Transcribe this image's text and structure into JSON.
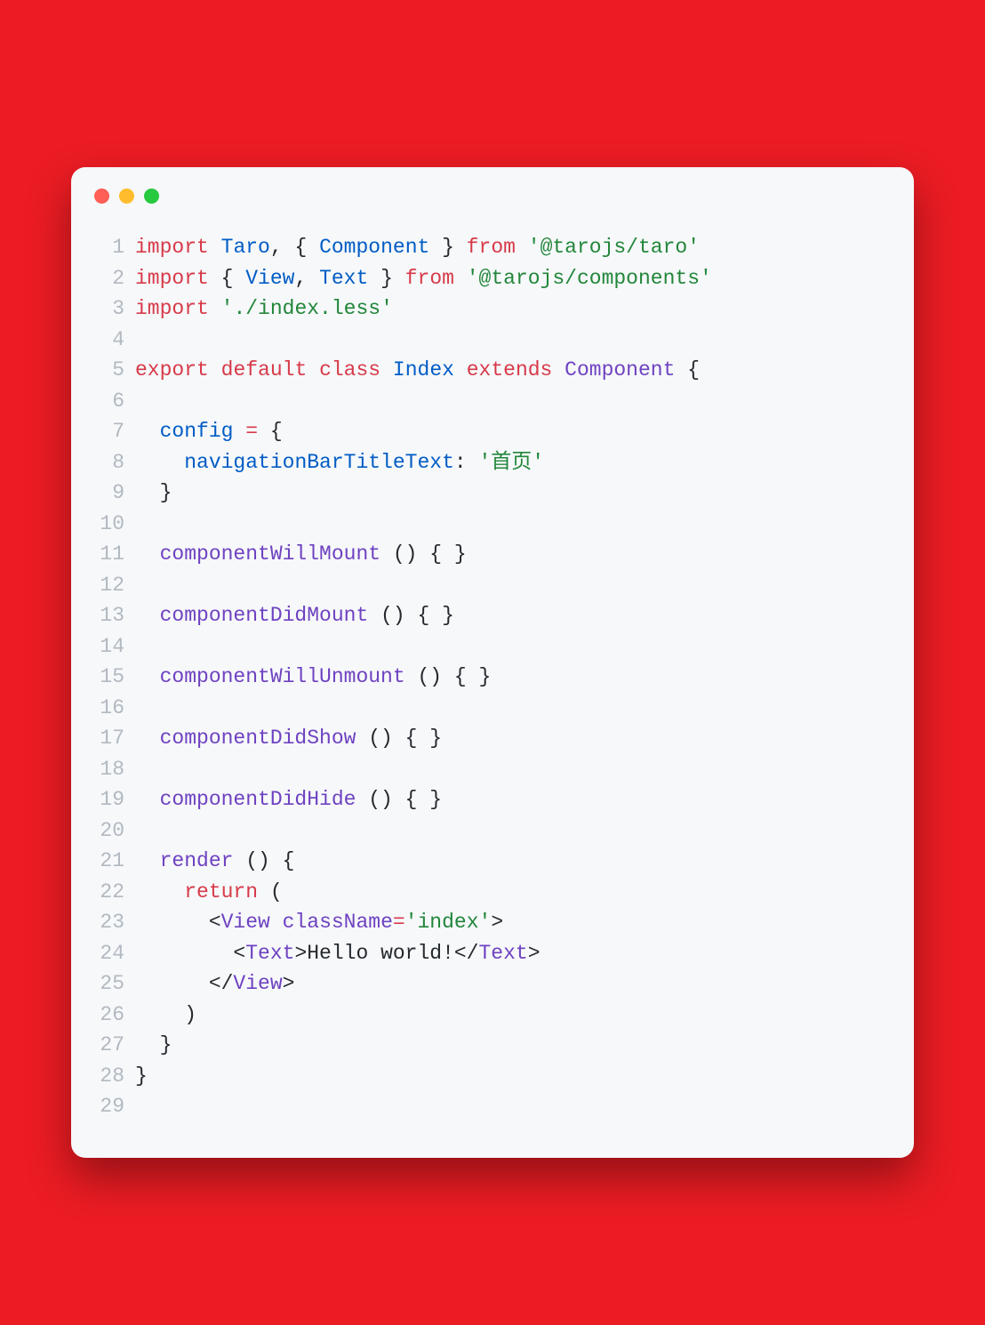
{
  "window": {
    "dots": [
      "red",
      "yellow",
      "green"
    ]
  },
  "code": {
    "lines": [
      {
        "n": 1,
        "tokens": [
          {
            "c": "kw",
            "t": "import"
          },
          {
            "c": "pl",
            "t": " "
          },
          {
            "c": "cls",
            "t": "Taro"
          },
          {
            "c": "pl",
            "t": ", { "
          },
          {
            "c": "cls",
            "t": "Component"
          },
          {
            "c": "pl",
            "t": " } "
          },
          {
            "c": "kw",
            "t": "from"
          },
          {
            "c": "pl",
            "t": " "
          },
          {
            "c": "str",
            "t": "'@tarojs/taro'"
          }
        ]
      },
      {
        "n": 2,
        "tokens": [
          {
            "c": "kw",
            "t": "import"
          },
          {
            "c": "pl",
            "t": " { "
          },
          {
            "c": "cls",
            "t": "View"
          },
          {
            "c": "pl",
            "t": ", "
          },
          {
            "c": "cls",
            "t": "Text"
          },
          {
            "c": "pl",
            "t": " } "
          },
          {
            "c": "kw",
            "t": "from"
          },
          {
            "c": "pl",
            "t": " "
          },
          {
            "c": "str",
            "t": "'@tarojs/components'"
          }
        ]
      },
      {
        "n": 3,
        "tokens": [
          {
            "c": "kw",
            "t": "import"
          },
          {
            "c": "pl",
            "t": " "
          },
          {
            "c": "str",
            "t": "'./index.less'"
          }
        ]
      },
      {
        "n": 4,
        "tokens": []
      },
      {
        "n": 5,
        "tokens": [
          {
            "c": "kw",
            "t": "export"
          },
          {
            "c": "pl",
            "t": " "
          },
          {
            "c": "kw",
            "t": "default"
          },
          {
            "c": "pl",
            "t": " "
          },
          {
            "c": "kw",
            "t": "class"
          },
          {
            "c": "pl",
            "t": " "
          },
          {
            "c": "cls",
            "t": "Index"
          },
          {
            "c": "pl",
            "t": " "
          },
          {
            "c": "kw",
            "t": "extends"
          },
          {
            "c": "pl",
            "t": " "
          },
          {
            "c": "def",
            "t": "Component"
          },
          {
            "c": "pl",
            "t": " {"
          }
        ]
      },
      {
        "n": 6,
        "tokens": []
      },
      {
        "n": 7,
        "tokens": [
          {
            "c": "pl",
            "t": "  "
          },
          {
            "c": "cls",
            "t": "config"
          },
          {
            "c": "pl",
            "t": " "
          },
          {
            "c": "kw",
            "t": "="
          },
          {
            "c": "pl",
            "t": " {"
          }
        ]
      },
      {
        "n": 8,
        "tokens": [
          {
            "c": "pl",
            "t": "    "
          },
          {
            "c": "attr",
            "t": "navigationBarTitleText"
          },
          {
            "c": "pl",
            "t": ": "
          },
          {
            "c": "str",
            "t": "'首页'"
          }
        ]
      },
      {
        "n": 9,
        "tokens": [
          {
            "c": "pl",
            "t": "  }"
          }
        ]
      },
      {
        "n": 10,
        "tokens": []
      },
      {
        "n": 11,
        "tokens": [
          {
            "c": "pl",
            "t": "  "
          },
          {
            "c": "def",
            "t": "componentWillMount"
          },
          {
            "c": "pl",
            "t": " () { }"
          }
        ]
      },
      {
        "n": 12,
        "tokens": []
      },
      {
        "n": 13,
        "tokens": [
          {
            "c": "pl",
            "t": "  "
          },
          {
            "c": "def",
            "t": "componentDidMount"
          },
          {
            "c": "pl",
            "t": " () { }"
          }
        ]
      },
      {
        "n": 14,
        "tokens": []
      },
      {
        "n": 15,
        "tokens": [
          {
            "c": "pl",
            "t": "  "
          },
          {
            "c": "def",
            "t": "componentWillUnmount"
          },
          {
            "c": "pl",
            "t": " () { }"
          }
        ]
      },
      {
        "n": 16,
        "tokens": []
      },
      {
        "n": 17,
        "tokens": [
          {
            "c": "pl",
            "t": "  "
          },
          {
            "c": "def",
            "t": "componentDidShow"
          },
          {
            "c": "pl",
            "t": " () { }"
          }
        ]
      },
      {
        "n": 18,
        "tokens": []
      },
      {
        "n": 19,
        "tokens": [
          {
            "c": "pl",
            "t": "  "
          },
          {
            "c": "def",
            "t": "componentDidHide"
          },
          {
            "c": "pl",
            "t": " () { }"
          }
        ]
      },
      {
        "n": 20,
        "tokens": []
      },
      {
        "n": 21,
        "tokens": [
          {
            "c": "pl",
            "t": "  "
          },
          {
            "c": "def",
            "t": "render"
          },
          {
            "c": "pl",
            "t": " () {"
          }
        ]
      },
      {
        "n": 22,
        "tokens": [
          {
            "c": "pl",
            "t": "    "
          },
          {
            "c": "kw",
            "t": "return"
          },
          {
            "c": "pl",
            "t": " ("
          }
        ]
      },
      {
        "n": 23,
        "tokens": [
          {
            "c": "pl",
            "t": "      <"
          },
          {
            "c": "def",
            "t": "View"
          },
          {
            "c": "pl",
            "t": " "
          },
          {
            "c": "def",
            "t": "className"
          },
          {
            "c": "kw",
            "t": "="
          },
          {
            "c": "str",
            "t": "'index'"
          },
          {
            "c": "pl",
            "t": ">"
          }
        ]
      },
      {
        "n": 24,
        "tokens": [
          {
            "c": "pl",
            "t": "        <"
          },
          {
            "c": "def",
            "t": "Text"
          },
          {
            "c": "pl",
            "t": ">Hello world!</"
          },
          {
            "c": "def",
            "t": "Text"
          },
          {
            "c": "pl",
            "t": ">"
          }
        ]
      },
      {
        "n": 25,
        "tokens": [
          {
            "c": "pl",
            "t": "      </"
          },
          {
            "c": "def",
            "t": "View"
          },
          {
            "c": "pl",
            "t": ">"
          }
        ]
      },
      {
        "n": 26,
        "tokens": [
          {
            "c": "pl",
            "t": "    )"
          }
        ]
      },
      {
        "n": 27,
        "tokens": [
          {
            "c": "pl",
            "t": "  }"
          }
        ]
      },
      {
        "n": 28,
        "tokens": [
          {
            "c": "pl",
            "t": "}"
          }
        ]
      },
      {
        "n": 29,
        "tokens": []
      }
    ]
  }
}
